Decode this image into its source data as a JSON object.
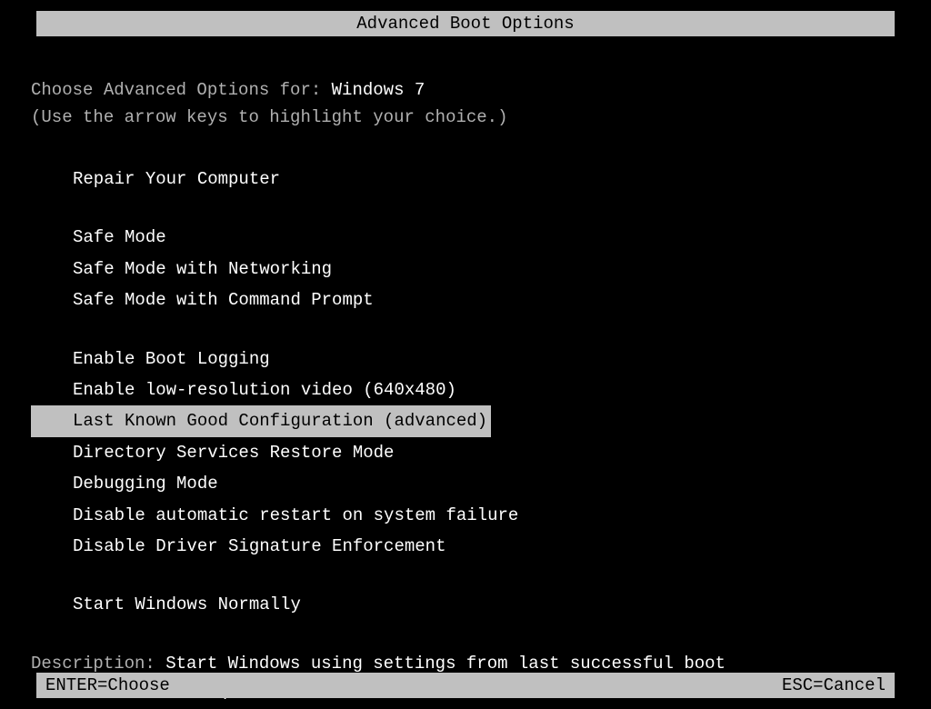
{
  "title": "Advanced Boot Options",
  "prompt_prefix": "Choose Advanced Options for: ",
  "os_name": "Windows 7",
  "hint": "(Use the arrow keys to highlight your choice.)",
  "groups": [
    {
      "items": [
        "Repair Your Computer"
      ]
    },
    {
      "items": [
        "Safe Mode",
        "Safe Mode with Networking",
        "Safe Mode with Command Prompt"
      ]
    },
    {
      "items": [
        "Enable Boot Logging",
        "Enable low-resolution video (640x480)",
        "Last Known Good Configuration (advanced)",
        "Directory Services Restore Mode",
        "Debugging Mode",
        "Disable automatic restart on system failure",
        "Disable Driver Signature Enforcement"
      ]
    },
    {
      "items": [
        "Start Windows Normally"
      ]
    }
  ],
  "selected": "Last Known Good Configuration (advanced)",
  "description_label": "Description: ",
  "description_line1": "Start Windows using settings from last successful boot",
  "description_line2": "attempt.",
  "footer_left": "ENTER=Choose",
  "footer_right": "ESC=Cancel"
}
